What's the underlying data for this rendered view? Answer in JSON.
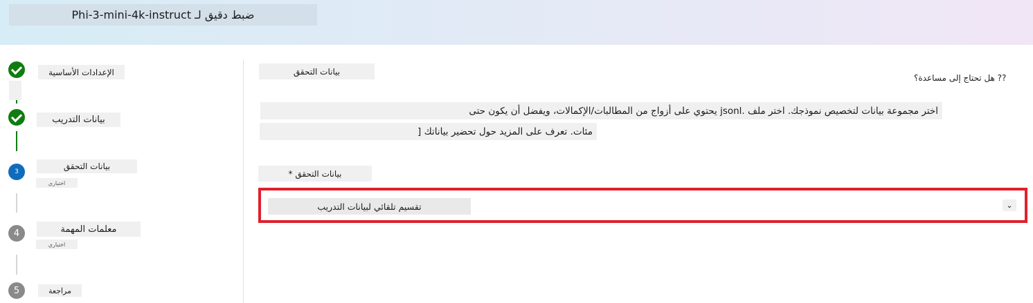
{
  "header": {
    "title": "ضبط دقيق لـ Phi-3-mini-4k-instruct"
  },
  "steps": [
    {
      "label": "الإعدادات الأساسية",
      "state": "done"
    },
    {
      "label": "بيانات التدريب",
      "state": "done"
    },
    {
      "label": "بيانات التحقق",
      "sub": "اختياري",
      "state": "current",
      "number": "3"
    },
    {
      "label": "معلمات المهمة",
      "sub": "اختياري",
      "state": "todo",
      "number": "4"
    },
    {
      "label": "مراجعة",
      "state": "todo",
      "number": "5"
    }
  ],
  "main": {
    "help_link": "?? هل تحتاج إلى مساعدة؟",
    "section_title": "بيانات التحقق",
    "description_line1": "اختر مجموعة بيانات لتخصيص نموذجك. اختر ملف .jsonl يحتوي على أزواج من المطالبات/الإكمالات، ويفضل أن يكون حتى",
    "description_line2": "مئات. تعرف على المزيد حول تحضير بياناتك [",
    "field_label": "بيانات التحقق *",
    "dropdown_value": "تقسيم تلقائي لبيانات التدريب",
    "dropdown_chevron": "⌄"
  },
  "colors": {
    "done": "#107c10",
    "current": "#0f6cbd",
    "todo": "#8a8a8a",
    "highlight": "#e0202c"
  }
}
